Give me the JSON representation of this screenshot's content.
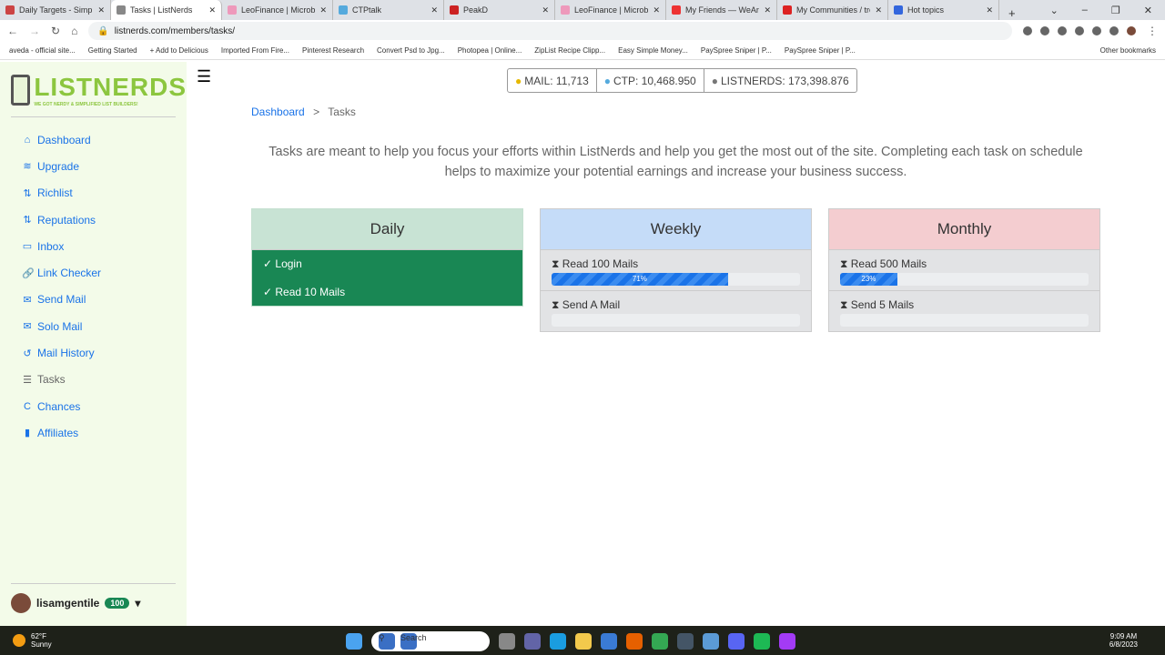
{
  "browser": {
    "tabs": [
      {
        "label": "Daily Targets - Simple"
      },
      {
        "label": "Tasks | ListNerds"
      },
      {
        "label": "LeoFinance | Microblo"
      },
      {
        "label": "CTPtalk"
      },
      {
        "label": "PeakD"
      },
      {
        "label": "LeoFinance | Microblo"
      },
      {
        "label": "My Friends — WeAre"
      },
      {
        "label": "My Communities / tre"
      },
      {
        "label": "Hot topics"
      }
    ],
    "url": "listnerds.com/members/tasks/",
    "bookmarks": [
      "aveda - official site...",
      "Getting Started",
      "+ Add to Delicious",
      "Imported From Fire...",
      "Pinterest Research",
      "Convert Psd to Jpg...",
      "Photopea | Online...",
      "ZipList Recipe Clipp...",
      "Easy Simple Money...",
      "PaySpree Sniper | P...",
      "PaySpree Sniper | P..."
    ],
    "other_bookmarks": "Other bookmarks"
  },
  "logo": {
    "text": "LISTNERDS",
    "tagline": "WE GOT NERDY & SIMPLIFIED LIST BUILDERS!"
  },
  "sidebar": {
    "items": [
      {
        "label": "Dashboard",
        "icon": "home-icon"
      },
      {
        "label": "Upgrade",
        "icon": "layers-icon"
      },
      {
        "label": "Richlist",
        "icon": "sort-icon"
      },
      {
        "label": "Reputations",
        "icon": "sort-icon"
      },
      {
        "label": "Inbox",
        "icon": "inbox-icon"
      },
      {
        "label": "Link Checker",
        "icon": "link-icon"
      },
      {
        "label": "Send Mail",
        "icon": "envelope-icon"
      },
      {
        "label": "Solo Mail",
        "icon": "envelope-open-icon"
      },
      {
        "label": "Mail History",
        "icon": "history-icon"
      },
      {
        "label": "Tasks",
        "icon": "tasks-icon"
      },
      {
        "label": "Chances",
        "icon": "c-icon"
      },
      {
        "label": "Affiliates",
        "icon": "signal-icon"
      }
    ],
    "user": {
      "name": "lisamgentile",
      "level": "100"
    }
  },
  "stats": {
    "mail": "MAIL: 11,713",
    "ctp": "CTP: 10,468.950",
    "listnerds": "LISTNERDS: 173,398.876"
  },
  "breadcrumb": {
    "home": "Dashboard",
    "sep": ">",
    "current": "Tasks"
  },
  "intro": "Tasks are meant to help you focus your efforts within ListNerds and help you get the most out of the site. Completing each task on schedule helps to maximize your potential earnings and increase your business success.",
  "cards": {
    "daily": {
      "title": "Daily",
      "items": [
        "Login",
        "Read 10 Mails"
      ],
      "color": "#198754"
    },
    "weekly": {
      "title": "Weekly",
      "items": [
        {
          "label": "Read 100 Mails",
          "progress": 71,
          "progress_label": "71%"
        },
        {
          "label": "Send A Mail",
          "progress": 0
        }
      ]
    },
    "monthly": {
      "title": "Monthly",
      "items": [
        {
          "label": "Read 500 Mails",
          "progress": 23,
          "progress_label": "23%"
        },
        {
          "label": "Send 5 Mails",
          "progress": 0
        }
      ]
    }
  },
  "taskbar": {
    "weather_temp": "62°F",
    "weather_desc": "Sunny",
    "search": "Search",
    "time": "9:09 AM",
    "date": "6/8/2023"
  }
}
